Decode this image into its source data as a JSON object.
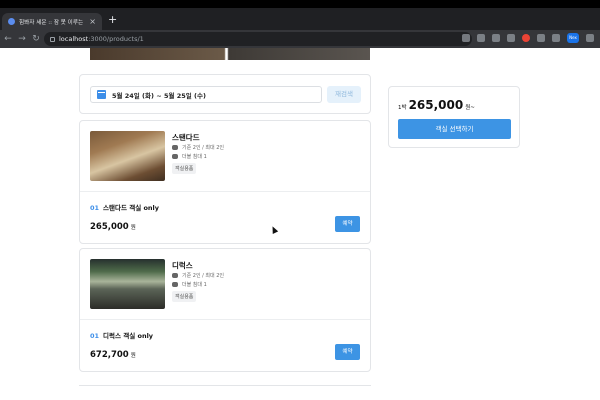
{
  "browser": {
    "tab_title": "힘봐자 세운 :: 잠 못 이루는 밤",
    "tab_close": "×",
    "new_tab": "+",
    "nav_back": "←",
    "nav_forward": "→",
    "nav_reload": "↻",
    "url_host": "localhost",
    "url_path": ":3000/products/1",
    "profile": "Nex"
  },
  "search": {
    "date_range": "5월 24일 (화) ~ 5월 25일 (수)",
    "research_label": "재검색"
  },
  "rooms": [
    {
      "name": "스탠다드",
      "capacity": "기준 2인 / 최대 2인",
      "bed": "더블 침대 1",
      "tag": "객실용품",
      "plan_number": "01",
      "plan_name": "스탠다드 객실 only",
      "price": "265,000",
      "currency": "원",
      "book_label": "예약"
    },
    {
      "name": "디럭스",
      "capacity": "기준 2인 / 최대 2인",
      "bed": "더블 침대 1",
      "tag": "객실용품",
      "plan_number": "01",
      "plan_name": "디럭스 객실 only",
      "price": "672,700",
      "currency": "원",
      "book_label": "예약"
    }
  ],
  "summary": {
    "prefix": "1박",
    "price": "265,000",
    "suffix": "원~",
    "select_label": "객실 선택하기"
  },
  "colors": {
    "accent": "#3d94e4",
    "accent_light": "#e5f1fb",
    "chrome_dark": "#35363a"
  }
}
